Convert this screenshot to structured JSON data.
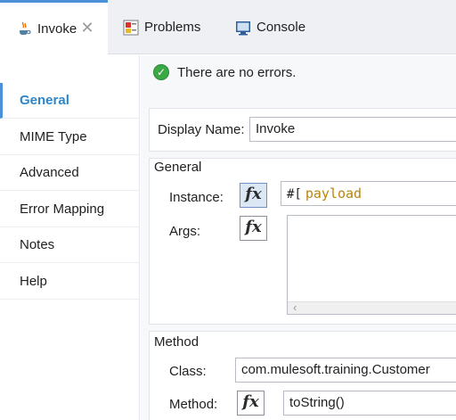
{
  "tabs": [
    {
      "label": "Invoke",
      "icon": "java-icon",
      "active": true,
      "closable": true
    },
    {
      "label": "Problems",
      "icon": "problems-icon",
      "active": false
    },
    {
      "label": "Console",
      "icon": "console-icon",
      "active": false
    }
  ],
  "sidebar": {
    "items": [
      {
        "label": "General",
        "active": true
      },
      {
        "label": "MIME Type"
      },
      {
        "label": "Advanced"
      },
      {
        "label": "Error Mapping"
      },
      {
        "label": "Notes"
      },
      {
        "label": "Help"
      }
    ]
  },
  "status": {
    "text": "There are no errors.",
    "icon": "check-circle-icon",
    "color": "#3aa845"
  },
  "display_name": {
    "label": "Display Name:",
    "value": "Invoke"
  },
  "general_section": {
    "title": "General",
    "instance": {
      "label": "Instance:",
      "prefix": "#[",
      "value": "payload"
    },
    "args": {
      "label": "Args:",
      "value": ""
    }
  },
  "method_section": {
    "title": "Method",
    "class": {
      "label": "Class:",
      "value": "com.mulesoft.training.Customer"
    },
    "method": {
      "label": "Method:",
      "value": "toString()"
    }
  },
  "fx_label": "fx",
  "accent_color": "#4a90d9"
}
